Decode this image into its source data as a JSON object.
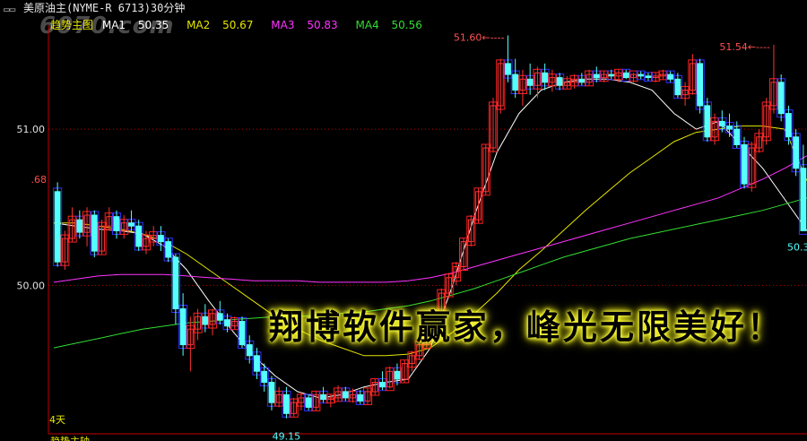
{
  "window": {
    "title": "美原油主(NYME-R 6713)30分钟",
    "watermark": "6070.com",
    "icon": "minimize-restore-icon"
  },
  "legend": {
    "main_label": "趋势主图",
    "items": [
      {
        "name": "MA1",
        "value": "50.35",
        "color": "#ffffff"
      },
      {
        "name": "MA2",
        "value": "50.67",
        "color": "#e6e600"
      },
      {
        "name": "MA3",
        "value": "50.83",
        "color": "#ff33ff"
      },
      {
        "name": "MA4",
        "value": "50.56",
        "color": "#33dd33"
      }
    ]
  },
  "banner_text": "翔博软件赢家，峰光无限美好！",
  "bottom_partial_text": "趋势主轴",
  "colors": {
    "up": "#ff3232",
    "down": "#54ffff",
    "box_up": "#ff2020",
    "box_down": "#3030ff",
    "axis": "#c00000",
    "grid": "#c00000"
  },
  "chart_data": {
    "type": "candlestick",
    "interval": "30分钟",
    "ylim": [
      49.05,
      51.62
    ],
    "y_ticks": [
      {
        "value": 51.0,
        "label": "51.00"
      },
      {
        "value": 50.0,
        "label": "50.00"
      }
    ],
    "annotations": [
      {
        "text": "51.60",
        "value": 51.6,
        "kind": "high-marker"
      },
      {
        "text": "51.54",
        "value": 51.54,
        "kind": "high-marker"
      },
      {
        "text": "49.15",
        "value": 49.15,
        "kind": "low-marker"
      },
      {
        "text": "50.3",
        "value": 50.35,
        "kind": "last-price"
      },
      {
        "text": ".68",
        "value": 50.68,
        "kind": "left-clipped-price"
      },
      {
        "text": "4天",
        "kind": "period-count"
      }
    ],
    "candles": [
      [
        50.6,
        50.66,
        50.12,
        50.15
      ],
      [
        50.15,
        50.35,
        50.1,
        50.3
      ],
      [
        50.3,
        50.5,
        50.28,
        50.42
      ],
      [
        50.42,
        50.48,
        50.3,
        50.34
      ],
      [
        50.34,
        50.5,
        50.25,
        50.45
      ],
      [
        50.45,
        50.48,
        50.18,
        50.22
      ],
      [
        50.22,
        50.42,
        50.2,
        50.38
      ],
      [
        50.38,
        50.5,
        50.35,
        50.44
      ],
      [
        50.44,
        50.48,
        50.3,
        50.35
      ],
      [
        50.35,
        50.45,
        50.3,
        50.4
      ],
      [
        50.4,
        50.48,
        50.34,
        50.38
      ],
      [
        50.38,
        50.42,
        50.22,
        50.25
      ],
      [
        50.25,
        50.35,
        50.2,
        50.3
      ],
      [
        50.3,
        50.38,
        50.25,
        50.32
      ],
      [
        50.32,
        50.38,
        50.22,
        50.28
      ],
      [
        50.28,
        50.3,
        50.15,
        50.18
      ],
      [
        50.18,
        50.2,
        49.75,
        49.85
      ],
      [
        49.85,
        49.95,
        49.55,
        49.62
      ],
      [
        49.62,
        49.8,
        49.45,
        49.72
      ],
      [
        49.72,
        49.85,
        49.65,
        49.8
      ],
      [
        49.8,
        49.88,
        49.7,
        49.75
      ],
      [
        49.75,
        49.85,
        49.68,
        49.82
      ],
      [
        49.82,
        49.9,
        49.75,
        49.78
      ],
      [
        49.78,
        49.82,
        49.7,
        49.74
      ],
      [
        49.74,
        49.8,
        49.72,
        49.77
      ],
      [
        49.77,
        49.8,
        49.6,
        49.62
      ],
      [
        49.62,
        49.68,
        49.5,
        49.55
      ],
      [
        49.55,
        49.6,
        49.4,
        49.45
      ],
      [
        49.45,
        49.5,
        49.32,
        49.38
      ],
      [
        49.38,
        49.42,
        49.2,
        49.25
      ],
      [
        49.25,
        49.35,
        49.22,
        49.3
      ],
      [
        49.3,
        49.35,
        49.15,
        49.18
      ],
      [
        49.18,
        49.28,
        49.16,
        49.25
      ],
      [
        49.25,
        49.32,
        49.2,
        49.28
      ],
      [
        49.28,
        49.3,
        49.2,
        49.22
      ],
      [
        49.22,
        49.32,
        49.2,
        49.3
      ],
      [
        49.3,
        49.35,
        49.25,
        49.27
      ],
      [
        49.27,
        49.3,
        49.22,
        49.28
      ],
      [
        49.28,
        49.36,
        49.26,
        49.32
      ],
      [
        49.32,
        49.35,
        49.26,
        49.28
      ],
      [
        49.28,
        49.34,
        49.25,
        49.3
      ],
      [
        49.3,
        49.33,
        49.24,
        49.26
      ],
      [
        49.26,
        49.34,
        49.24,
        49.32
      ],
      [
        49.32,
        49.4,
        49.3,
        49.38
      ],
      [
        49.38,
        49.45,
        49.33,
        49.35
      ],
      [
        49.35,
        49.48,
        49.34,
        49.45
      ],
      [
        49.45,
        49.5,
        49.36,
        49.4
      ],
      [
        49.4,
        49.52,
        49.38,
        49.5
      ],
      [
        49.5,
        49.58,
        49.45,
        49.55
      ],
      [
        49.55,
        49.65,
        49.52,
        49.62
      ],
      [
        49.62,
        49.75,
        49.6,
        49.72
      ],
      [
        49.72,
        49.85,
        49.7,
        49.82
      ],
      [
        49.82,
        49.98,
        49.8,
        49.95
      ],
      [
        49.95,
        50.08,
        49.92,
        50.05
      ],
      [
        50.05,
        50.15,
        50.0,
        50.12
      ],
      [
        50.12,
        50.3,
        50.1,
        50.28
      ],
      [
        50.28,
        50.45,
        50.25,
        50.42
      ],
      [
        50.42,
        50.62,
        50.4,
        50.6
      ],
      [
        50.6,
        50.9,
        50.58,
        50.88
      ],
      [
        50.88,
        51.2,
        50.85,
        51.15
      ],
      [
        51.15,
        51.45,
        51.1,
        51.42
      ],
      [
        51.42,
        51.6,
        51.3,
        51.35
      ],
      [
        51.35,
        51.45,
        51.2,
        51.25
      ],
      [
        51.25,
        51.38,
        51.15,
        51.32
      ],
      [
        51.32,
        51.42,
        51.22,
        51.28
      ],
      [
        51.28,
        51.4,
        51.2,
        51.36
      ],
      [
        51.36,
        51.42,
        51.25,
        51.3
      ],
      [
        51.3,
        51.38,
        51.24,
        51.33
      ],
      [
        51.33,
        51.36,
        51.25,
        51.28
      ],
      [
        51.28,
        51.34,
        51.26,
        51.3
      ],
      [
        51.3,
        51.35,
        51.26,
        51.32
      ],
      [
        51.32,
        51.36,
        51.28,
        51.3
      ],
      [
        51.3,
        51.38,
        51.28,
        51.35
      ],
      [
        51.35,
        51.4,
        51.3,
        51.33
      ],
      [
        51.33,
        51.37,
        51.3,
        51.35
      ],
      [
        51.35,
        51.38,
        51.32,
        51.34
      ],
      [
        51.34,
        51.38,
        51.3,
        51.36
      ],
      [
        51.36,
        51.38,
        51.32,
        51.33
      ],
      [
        51.33,
        51.36,
        51.3,
        51.35
      ],
      [
        51.35,
        51.37,
        51.32,
        51.34
      ],
      [
        51.34,
        51.36,
        51.31,
        51.33
      ],
      [
        51.33,
        51.36,
        51.3,
        51.34
      ],
      [
        51.34,
        51.38,
        51.32,
        51.35
      ],
      [
        51.35,
        51.37,
        51.3,
        51.32
      ],
      [
        51.32,
        51.36,
        51.2,
        51.22
      ],
      [
        51.22,
        51.3,
        51.15,
        51.25
      ],
      [
        51.25,
        51.48,
        51.22,
        51.42
      ],
      [
        51.42,
        51.45,
        51.1,
        51.15
      ],
      [
        51.15,
        51.2,
        50.92,
        50.95
      ],
      [
        50.95,
        51.1,
        50.9,
        51.05
      ],
      [
        51.05,
        51.12,
        50.98,
        51.02
      ],
      [
        51.02,
        51.1,
        50.95,
        51.0
      ],
      [
        51.0,
        51.05,
        50.88,
        50.9
      ],
      [
        50.9,
        50.95,
        50.62,
        50.65
      ],
      [
        50.65,
        50.92,
        50.6,
        50.88
      ],
      [
        50.88,
        51.0,
        50.85,
        50.95
      ],
      [
        50.95,
        51.2,
        50.9,
        51.15
      ],
      [
        51.15,
        51.54,
        51.1,
        51.3
      ],
      [
        51.3,
        51.35,
        51.05,
        51.1
      ],
      [
        51.1,
        51.15,
        50.9,
        50.95
      ],
      [
        50.95,
        51.0,
        50.7,
        50.75
      ],
      [
        50.75,
        50.9,
        50.4,
        50.35
      ]
    ],
    "ma_lines": [
      {
        "name": "MA1",
        "values": [
          50.4,
          50.38,
          50.36,
          50.35,
          50.33,
          50.25,
          50.1,
          49.9,
          49.72,
          49.55,
          49.42,
          49.32,
          49.28,
          49.3,
          49.35,
          49.38,
          49.4,
          49.6,
          50.0,
          50.45,
          50.85,
          51.1,
          51.25,
          51.3,
          51.32,
          51.32,
          51.3,
          51.25,
          51.1,
          51.0,
          51.05,
          50.9,
          50.75,
          50.55,
          50.35
        ]
      },
      {
        "name": "MA2",
        "values": [
          50.4,
          50.4,
          50.38,
          50.36,
          50.33,
          50.28,
          50.2,
          50.1,
          50.0,
          49.9,
          49.8,
          49.72,
          49.65,
          49.6,
          49.55,
          49.55,
          49.56,
          49.6,
          49.7,
          49.82,
          49.95,
          50.1,
          50.22,
          50.35,
          50.48,
          50.6,
          50.72,
          50.82,
          50.92,
          50.98,
          51.0,
          51.02,
          51.02,
          51.0,
          50.67
        ]
      },
      {
        "name": "MA3",
        "values": [
          50.02,
          50.04,
          50.06,
          50.07,
          50.07,
          50.07,
          50.06,
          50.05,
          50.04,
          50.03,
          50.03,
          50.03,
          50.02,
          50.02,
          50.02,
          50.02,
          50.03,
          50.05,
          50.08,
          50.12,
          50.16,
          50.2,
          50.24,
          50.28,
          50.32,
          50.36,
          50.4,
          50.44,
          50.48,
          50.52,
          50.56,
          50.62,
          50.68,
          50.75,
          50.83
        ]
      },
      {
        "name": "MA4",
        "values": [
          49.6,
          49.63,
          49.66,
          49.69,
          49.72,
          49.74,
          49.76,
          49.77,
          49.78,
          49.79,
          49.8,
          49.8,
          49.81,
          49.82,
          49.83,
          49.85,
          49.87,
          49.9,
          49.94,
          49.98,
          50.03,
          50.08,
          50.13,
          50.18,
          50.22,
          50.26,
          50.3,
          50.33,
          50.36,
          50.39,
          50.42,
          50.45,
          50.48,
          50.52,
          50.56
        ]
      }
    ]
  }
}
